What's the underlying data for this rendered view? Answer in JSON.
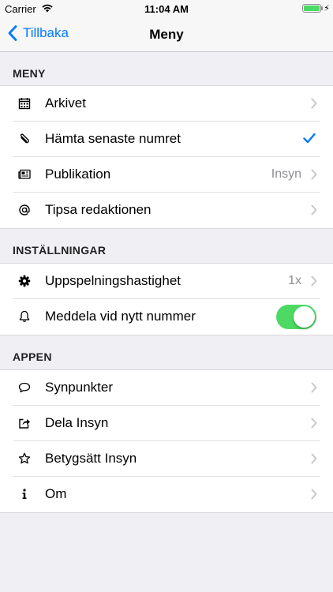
{
  "status": {
    "carrier": "Carrier",
    "time": "11:04 AM"
  },
  "nav": {
    "back_label": "Tillbaka",
    "title": "Meny"
  },
  "colors": {
    "accent": "#007aff",
    "toggle_on": "#4cd964"
  },
  "sections": {
    "meny": {
      "header": "MENY",
      "items": [
        {
          "label": "Arkivet",
          "icon": "calendar-icon"
        },
        {
          "label": "Hämta senaste numret",
          "icon": "paperclip-icon",
          "checked": true
        },
        {
          "label": "Publikation",
          "icon": "newspaper-icon",
          "detail": "Insyn"
        },
        {
          "label": "Tipsa redaktionen",
          "icon": "at-icon"
        }
      ]
    },
    "installningar": {
      "header": "INSTÄLLNINGAR",
      "items": [
        {
          "label": "Uppspelningshastighet",
          "icon": "gear-icon",
          "detail": "1x"
        },
        {
          "label": "Meddela vid nytt nummer",
          "icon": "bell-icon",
          "toggle_on": true
        }
      ]
    },
    "appen": {
      "header": "APPEN",
      "items": [
        {
          "label": "Synpunkter",
          "icon": "speech-bubble-icon"
        },
        {
          "label": "Dela Insyn",
          "icon": "share-icon"
        },
        {
          "label": "Betygsätt Insyn",
          "icon": "star-icon"
        },
        {
          "label": "Om",
          "icon": "info-icon"
        }
      ]
    }
  }
}
